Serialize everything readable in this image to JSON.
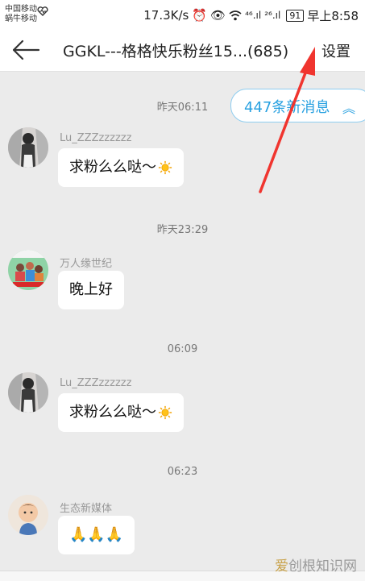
{
  "status": {
    "carrier1": "中国移动",
    "carrier2": "蜗牛移动",
    "speed": "17.3K/s",
    "signal1": "⁴⁶.ıl",
    "signal2": "²⁶.ıl",
    "battery": "91",
    "time": "早上8:58"
  },
  "header": {
    "title": "GGKL---格格快乐粉丝15...(685)",
    "settings_label": "设置"
  },
  "new_messages": {
    "label": "447条新消息",
    "chevron": "︽"
  },
  "messages": [
    {
      "time": "昨天06:11",
      "sender": "Lu_ZZZzzzzzz",
      "text": "求粉么么哒～",
      "emoji": "sun-icon"
    },
    {
      "time": "昨天23:29",
      "sender": "万人缘世纪",
      "text": "晚上好"
    },
    {
      "time": "06:09",
      "sender": "Lu_ZZZzzzzzz",
      "text": "求粉么么哒～",
      "emoji": "sun-icon"
    },
    {
      "time": "06:23",
      "sender": "生态新媒体",
      "text": "🙏🙏🙏"
    }
  ],
  "watermark": {
    "part1": "爱",
    "part2": "创根知识网"
  },
  "colors": {
    "accent": "#27a0e0",
    "arrow": "#f0352f"
  }
}
